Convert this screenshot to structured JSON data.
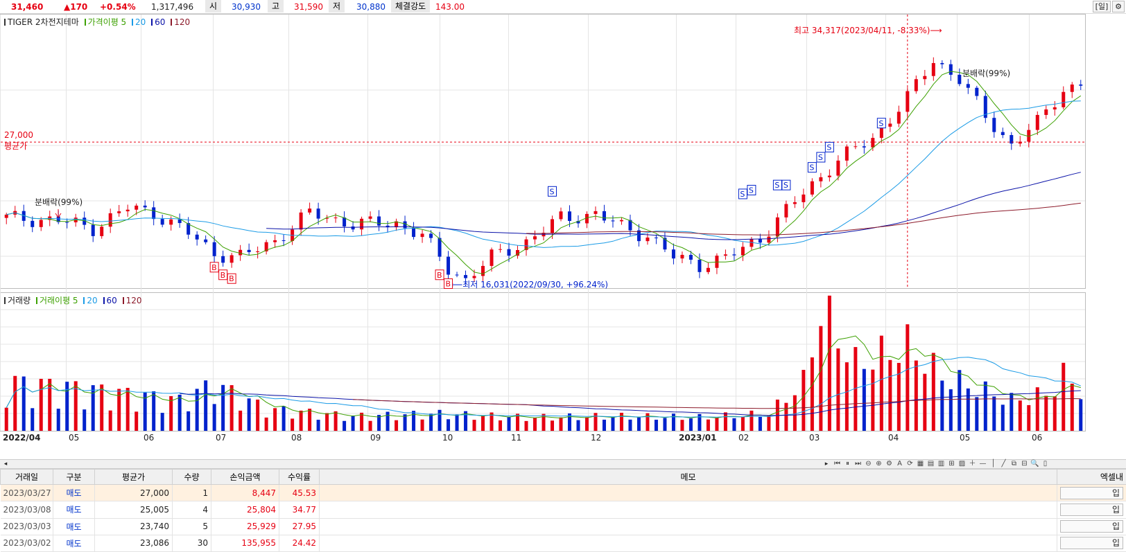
{
  "quote": {
    "price": "31,460",
    "change": "▲170",
    "change_pct": "+0.54%",
    "volume": "1,317,496",
    "open_label": "시",
    "open": "30,930",
    "high_label": "고",
    "high": "31,590",
    "low_label": "저",
    "low": "30,880",
    "strength_label": "체결강도",
    "strength": "143.00",
    "day_button": "[일]",
    "gear_icon": "⚙"
  },
  "price_panel": {
    "name": "TIGER 2차전지테마",
    "ma_label": "가격이평 5",
    "ma_periods": [
      "20",
      "60",
      "120"
    ],
    "high_annotation": "최고 34,317(2023/04/11, -8.33%)",
    "low_annotation": "최저 16,031(2022/09/30, +96.24%)",
    "avg_price_value": "27,000",
    "avg_price_label": "평균가",
    "dividend_label_1": "분배락(99%)",
    "dividend_label_2": "분배락(99%)",
    "buy_marker": "B",
    "sell_marker": "S"
  },
  "volume_panel": {
    "name": "거래량",
    "ma_label": "거래이평 5",
    "ma_periods": [
      "20",
      "60",
      "120"
    ]
  },
  "x_axis": [
    "2022/04",
    "05",
    "06",
    "07",
    "08",
    "09",
    "10",
    "11",
    "12",
    "2023/01",
    "02",
    "03",
    "04",
    "05",
    "06"
  ],
  "colors": {
    "up": "#e60012",
    "down": "#0022cc",
    "ma5": "#3ca000",
    "ma20": "#1a9be6",
    "ma60": "#0a12a8",
    "ma120": "#8c1a2a",
    "grid": "#e4e4e4"
  },
  "chart_data": {
    "type": "candlestick",
    "x_range": [
      "2022/04",
      "2023/06"
    ],
    "price_range_approx": [
      15500,
      35500
    ],
    "high": {
      "value": 34317,
      "date": "2023/04/11"
    },
    "low": {
      "value": 16031,
      "date": "2022/09/30"
    },
    "avg_price": 27000,
    "last_close": 31460,
    "price_path": [
      [
        0,
        21000
      ],
      [
        6,
        20800
      ],
      [
        10,
        20200
      ],
      [
        14,
        21800
      ],
      [
        17,
        21400
      ],
      [
        21,
        19800
      ],
      [
        24,
        18200
      ],
      [
        27,
        17900
      ],
      [
        31,
        19200
      ],
      [
        35,
        21400
      ],
      [
        40,
        20500
      ],
      [
        45,
        20600
      ],
      [
        48,
        19600
      ],
      [
        51,
        17000
      ],
      [
        53,
        16100
      ],
      [
        56,
        17900
      ],
      [
        60,
        19100
      ],
      [
        64,
        21000
      ],
      [
        68,
        21300
      ],
      [
        71,
        20300
      ],
      [
        74,
        19600
      ],
      [
        77,
        17900
      ],
      [
        80,
        17300
      ],
      [
        83,
        17800
      ],
      [
        87,
        19400
      ],
      [
        92,
        23000
      ],
      [
        96,
        25600
      ],
      [
        100,
        27300
      ],
      [
        104,
        30500
      ],
      [
        107,
        33500
      ],
      [
        110,
        32000
      ],
      [
        113,
        29000
      ],
      [
        116,
        26800
      ],
      [
        119,
        28500
      ],
      [
        122,
        31200
      ],
      [
        124,
        31460
      ]
    ],
    "volume_path": [
      [
        0,
        40
      ],
      [
        8,
        35
      ],
      [
        14,
        30
      ],
      [
        20,
        25
      ],
      [
        24,
        38
      ],
      [
        30,
        18
      ],
      [
        40,
        12
      ],
      [
        50,
        14
      ],
      [
        60,
        11
      ],
      [
        70,
        12
      ],
      [
        80,
        11
      ],
      [
        88,
        14
      ],
      [
        92,
        40
      ],
      [
        94,
        100
      ],
      [
        98,
        55
      ],
      [
        104,
        70
      ],
      [
        108,
        45
      ],
      [
        112,
        35
      ],
      [
        116,
        25
      ],
      [
        120,
        30
      ],
      [
        122,
        45
      ],
      [
        124,
        35
      ]
    ]
  },
  "scroll": {
    "left_arrow": "◂",
    "right_arrow": "▸"
  },
  "toolbar": [
    "⏮",
    "⏸",
    "⏭",
    "⊖",
    "⊕",
    "⚙",
    "A",
    "⟳",
    "▦",
    "▤",
    "▥",
    "⊞",
    "▨",
    "＋",
    "—",
    "│",
    "╱",
    "⧉",
    "⊟",
    "🔍",
    "▯"
  ],
  "table": {
    "headers": [
      "거래일",
      "구분",
      "평균가",
      "수량",
      "손익금액",
      "수익률",
      "메모",
      "엑셀내"
    ],
    "rows": [
      {
        "date": "2023/03/27",
        "type": "매도",
        "avg": "27,000",
        "qty": "1",
        "pnl": "8,447",
        "rate": "45.53",
        "btn": "입"
      },
      {
        "date": "2023/03/08",
        "type": "매도",
        "avg": "25,005",
        "qty": "4",
        "pnl": "25,804",
        "rate": "34.77",
        "btn": "입"
      },
      {
        "date": "2023/03/03",
        "type": "매도",
        "avg": "23,740",
        "qty": "5",
        "pnl": "25,929",
        "rate": "27.95",
        "btn": "입"
      },
      {
        "date": "2023/03/02",
        "type": "매도",
        "avg": "23,086",
        "qty": "30",
        "pnl": "135,955",
        "rate": "24.42",
        "btn": "입"
      }
    ]
  }
}
